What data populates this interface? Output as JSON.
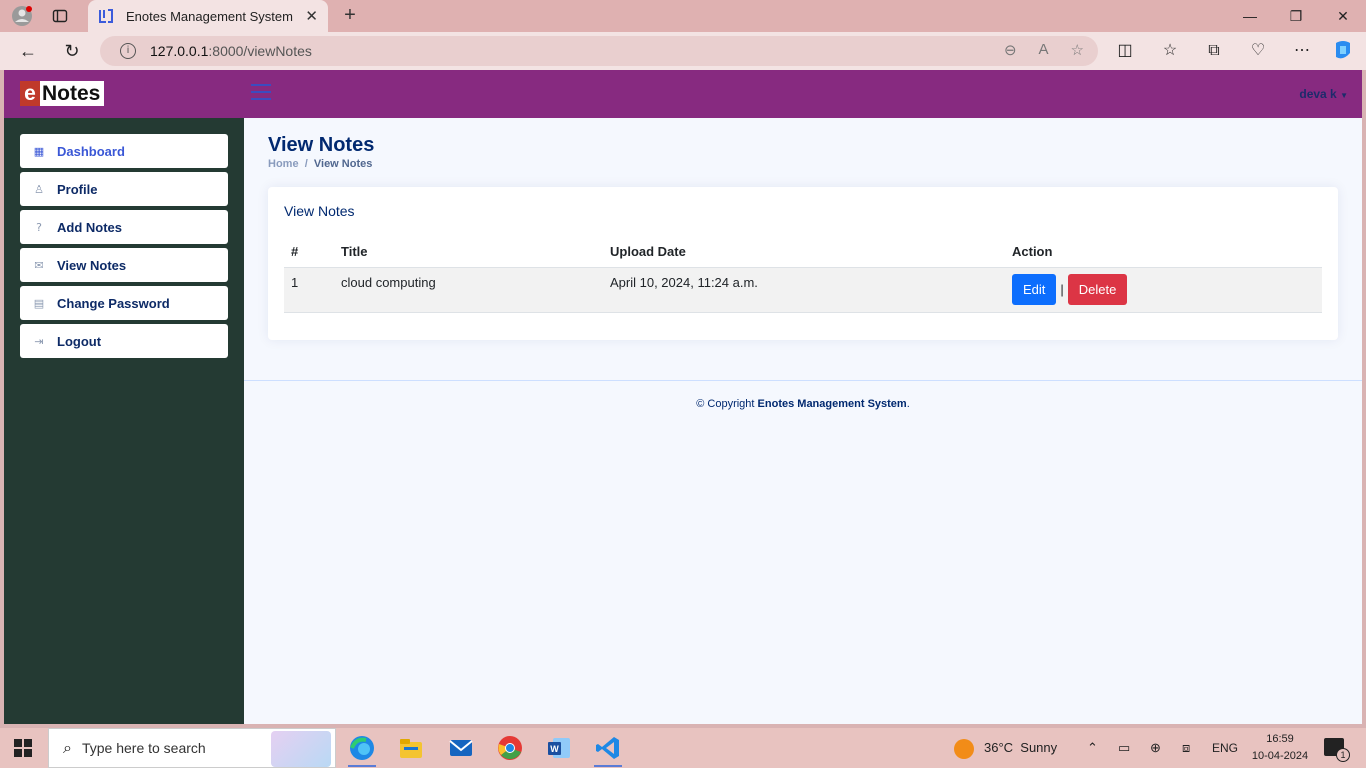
{
  "browser": {
    "tab_title": "Enotes Management System",
    "url_host": "127.0.0.1",
    "url_path": ":8000/viewNotes"
  },
  "app": {
    "logo_e": "e",
    "logo_rest": "Notes",
    "user_name": "deva k"
  },
  "sidebar": {
    "items": [
      {
        "label": "Dashboard",
        "icon": "grid-icon"
      },
      {
        "label": "Profile",
        "icon": "person-icon"
      },
      {
        "label": "Add Notes",
        "icon": "question-icon"
      },
      {
        "label": "View Notes",
        "icon": "envelope-icon"
      },
      {
        "label": "Change Password",
        "icon": "card-icon"
      },
      {
        "label": "Logout",
        "icon": "logout-icon"
      }
    ]
  },
  "main": {
    "page_title": "View Notes",
    "breadcrumb_home": "Home",
    "breadcrumb_sep": "/",
    "breadcrumb_current": "View Notes",
    "card_title": "View Notes",
    "table": {
      "headers": [
        "#",
        "Title",
        "Upload Date",
        "Action"
      ],
      "rows": [
        {
          "num": "1",
          "title": "cloud computing",
          "date": "April 10, 2024, 11:24 a.m."
        }
      ],
      "edit_label": "Edit",
      "delete_label": "Delete",
      "separator": "|"
    },
    "footer_prefix": "© Copyright",
    "footer_brand": "Enotes Management System",
    "footer_suffix": "."
  },
  "taskbar": {
    "search_placeholder": "Type here to search",
    "weather_temp": "36°C",
    "weather_text": "Sunny",
    "lang": "ENG",
    "time": "16:59",
    "date": "10-04-2024",
    "notif_count": "1"
  },
  "colors": {
    "header": "#872a80",
    "sidebar": "#243a33",
    "edit": "#0d6efd",
    "delete": "#dc3545"
  }
}
